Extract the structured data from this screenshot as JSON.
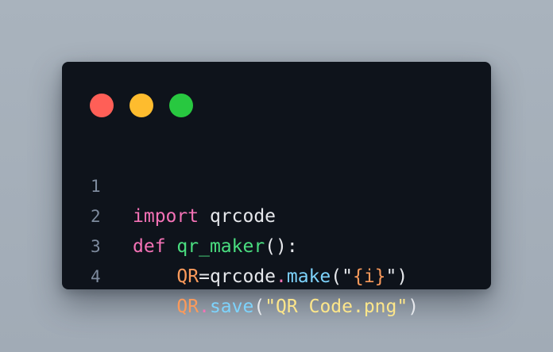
{
  "colors": {
    "background": "#a3adb8",
    "window": "#0e131b",
    "close": "#ff5f57",
    "minimize": "#febc2e",
    "maximize": "#28c840",
    "keyword": "#f472b6",
    "function": "#4ade80",
    "variable": "#fb9a5b",
    "method": "#7dd3fc",
    "string": "#fde68a",
    "line_number": "#7e8b9e"
  },
  "window_controls": [
    "close-dot",
    "minimize-dot",
    "maximize-dot"
  ],
  "code": {
    "lines": [
      {
        "number": "1",
        "tokens": [
          {
            "text": "import",
            "kind": "kw"
          },
          {
            "text": " qrcode",
            "kind": "plain"
          }
        ]
      },
      {
        "number": "2",
        "tokens": [
          {
            "text": "def",
            "kind": "kw"
          },
          {
            "text": " ",
            "kind": "plain"
          },
          {
            "text": "qr_maker",
            "kind": "fn"
          },
          {
            "text": "():",
            "kind": "punc"
          }
        ]
      },
      {
        "number": "3",
        "tokens": [
          {
            "text": "    ",
            "kind": "plain"
          },
          {
            "text": "QR",
            "kind": "var"
          },
          {
            "text": "=qrcode",
            "kind": "plain"
          },
          {
            "text": ".",
            "kind": "dotc"
          },
          {
            "text": "make",
            "kind": "meth"
          },
          {
            "text": "(\"",
            "kind": "punc"
          },
          {
            "text": "{i}",
            "kind": "interp"
          },
          {
            "text": "\")",
            "kind": "punc"
          }
        ]
      },
      {
        "number": "4",
        "tokens": [
          {
            "text": "    ",
            "kind": "plain"
          },
          {
            "text": "QR",
            "kind": "var"
          },
          {
            "text": ".",
            "kind": "dotc"
          },
          {
            "text": "save",
            "kind": "meth"
          },
          {
            "text": "(",
            "kind": "punc"
          },
          {
            "text": "\"QR Code.png\"",
            "kind": "str"
          },
          {
            "text": ")",
            "kind": "punc"
          }
        ]
      }
    ]
  }
}
